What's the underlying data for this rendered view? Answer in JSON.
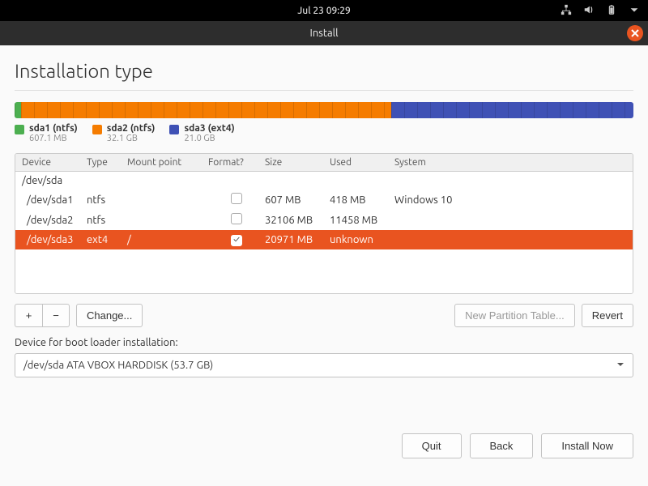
{
  "topbar": {
    "datetime": "Jul 23  09:29"
  },
  "titlebar": {
    "title": "Install"
  },
  "heading": "Installation type",
  "disk_bar": [
    {
      "color": "green",
      "flex": 1.1
    },
    {
      "color": "orange",
      "flex": 59.8
    },
    {
      "color": "blue",
      "flex": 39.1
    }
  ],
  "legend": [
    {
      "color": "green",
      "label": "sda1 (ntfs)",
      "size": "607.1 MB"
    },
    {
      "color": "orange",
      "label": "sda2 (ntfs)",
      "size": "32.1 GB"
    },
    {
      "color": "blue",
      "label": "sda3 (ext4)",
      "size": "21.0 GB"
    }
  ],
  "columns": {
    "device": "Device",
    "type": "Type",
    "mount": "Mount point",
    "format": "Format?",
    "size": "Size",
    "used": "Used",
    "system": "System"
  },
  "rows": [
    {
      "device": "/dev/sda",
      "type": "",
      "mount": "",
      "format": null,
      "size": "",
      "used": "",
      "system": "",
      "indent": false,
      "selected": false
    },
    {
      "device": "/dev/sda1",
      "type": "ntfs",
      "mount": "",
      "format": false,
      "size": "607 MB",
      "used": "418 MB",
      "system": "Windows 10",
      "indent": true,
      "selected": false
    },
    {
      "device": "/dev/sda2",
      "type": "ntfs",
      "mount": "",
      "format": false,
      "size": "32106 MB",
      "used": "11458 MB",
      "system": "",
      "indent": true,
      "selected": false
    },
    {
      "device": "/dev/sda3",
      "type": "ext4",
      "mount": "/",
      "format": true,
      "size": "20971 MB",
      "used": "unknown",
      "system": "",
      "indent": true,
      "selected": true
    }
  ],
  "toolbar": {
    "add": "+",
    "remove": "−",
    "change": "Change...",
    "new_table": "New Partition Table...",
    "revert": "Revert"
  },
  "bootloader": {
    "label": "Device for boot loader installation:",
    "value": "/dev/sda   ATA VBOX HARDDISK (53.7 GB)"
  },
  "footer": {
    "quit": "Quit",
    "back": "Back",
    "install": "Install Now"
  }
}
